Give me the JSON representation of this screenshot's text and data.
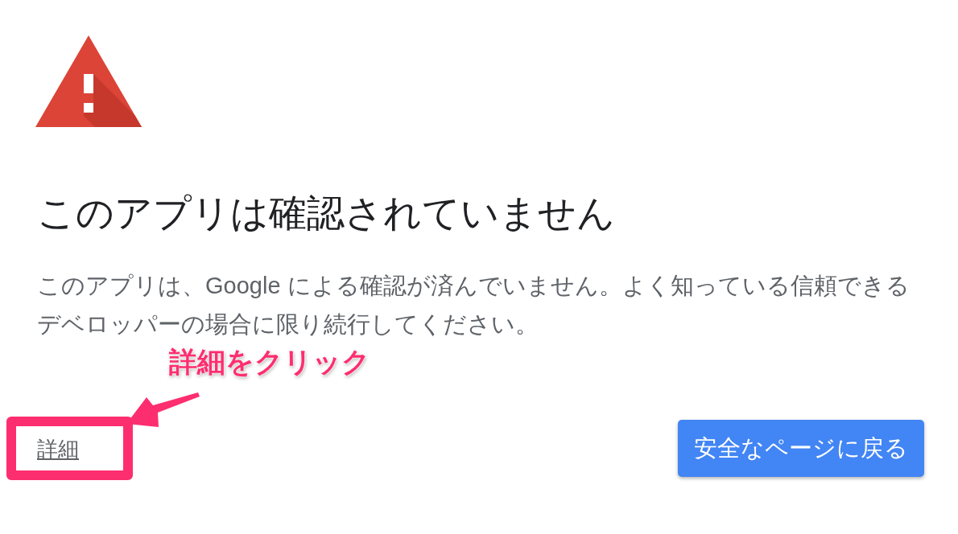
{
  "heading": "このアプリは確認されていません",
  "message": "このアプリは、Google による確認が済んでいません。よく知っている信頼できるデベロッパーの場合に限り続行してください。",
  "annotation": {
    "callout": "詳細をクリック"
  },
  "actions": {
    "details_link": "詳細",
    "back_button": "安全なページに戻る"
  }
}
